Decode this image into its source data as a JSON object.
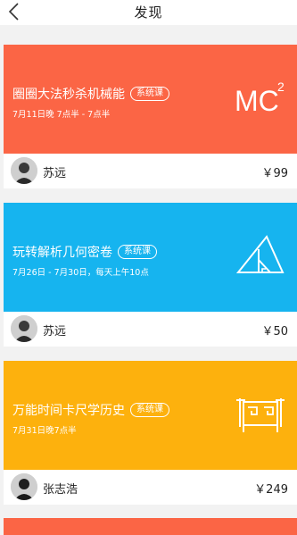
{
  "header": {
    "title": "发现"
  },
  "courses": [
    {
      "title": "圈圈大法秒杀机械能",
      "tag": "系统课",
      "time": "7月11日晚 7点半 - 7点半",
      "icon": "mc2-icon",
      "icon_text": "MC",
      "icon_sup": "2",
      "color": "#fb6545",
      "teacher": "苏远",
      "price": "￥99"
    },
    {
      "title": "玩转解析几何密卷",
      "tag": "系统课",
      "time": "7月26日 - 7月30日，每天上午10点",
      "icon": "triangle-icon",
      "color": "#16b4ef",
      "teacher": "苏远",
      "price": "￥50"
    },
    {
      "title": "万能时间卡尺学历史",
      "tag": "系统课",
      "time": "7月31日晚7点半",
      "icon": "ancient-vessel-icon",
      "color": "#fdb10d",
      "teacher": "张志浩",
      "price": "￥249"
    }
  ],
  "colors": {
    "next_card": "#fb6545",
    "background": "#f2f2f2"
  }
}
